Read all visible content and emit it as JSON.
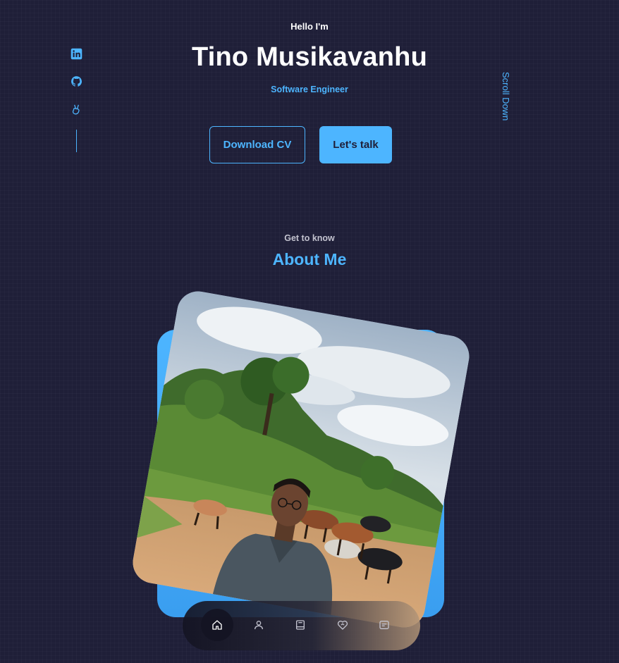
{
  "hero": {
    "greeting": "Hello I'm",
    "name": "Tino Musikavanhu",
    "role": "Software Engineer",
    "download_cv": "Download CV",
    "lets_talk": "Let's talk",
    "scroll_down": "Scroll Down"
  },
  "socials": [
    {
      "icon": "linkedin-icon"
    },
    {
      "icon": "github-icon"
    },
    {
      "icon": "angellist-icon"
    }
  ],
  "about": {
    "subtitle": "Get to know",
    "title": "About Me"
  },
  "nav": {
    "items": [
      {
        "icon": "home-icon",
        "active": true
      },
      {
        "icon": "user-icon",
        "active": false
      },
      {
        "icon": "book-icon",
        "active": false
      },
      {
        "icon": "heart-handshake-icon",
        "active": false
      },
      {
        "icon": "message-icon",
        "active": false
      }
    ]
  },
  "colors": {
    "background": "#1f1f38",
    "accent": "#4db5ff",
    "text": "#ffffff"
  }
}
